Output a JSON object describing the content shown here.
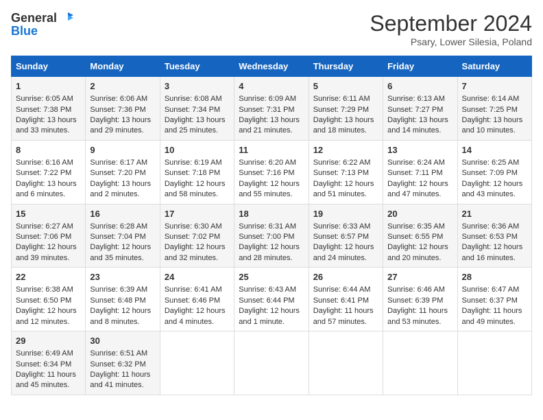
{
  "header": {
    "logo_line1": "General",
    "logo_line2": "Blue",
    "month": "September 2024",
    "location": "Psary, Lower Silesia, Poland"
  },
  "columns": [
    "Sunday",
    "Monday",
    "Tuesday",
    "Wednesday",
    "Thursday",
    "Friday",
    "Saturday"
  ],
  "weeks": [
    [
      {
        "day": "1",
        "lines": [
          "Sunrise: 6:05 AM",
          "Sunset: 7:38 PM",
          "Daylight: 13 hours",
          "and 33 minutes."
        ]
      },
      {
        "day": "2",
        "lines": [
          "Sunrise: 6:06 AM",
          "Sunset: 7:36 PM",
          "Daylight: 13 hours",
          "and 29 minutes."
        ]
      },
      {
        "day": "3",
        "lines": [
          "Sunrise: 6:08 AM",
          "Sunset: 7:34 PM",
          "Daylight: 13 hours",
          "and 25 minutes."
        ]
      },
      {
        "day": "4",
        "lines": [
          "Sunrise: 6:09 AM",
          "Sunset: 7:31 PM",
          "Daylight: 13 hours",
          "and 21 minutes."
        ]
      },
      {
        "day": "5",
        "lines": [
          "Sunrise: 6:11 AM",
          "Sunset: 7:29 PM",
          "Daylight: 13 hours",
          "and 18 minutes."
        ]
      },
      {
        "day": "6",
        "lines": [
          "Sunrise: 6:13 AM",
          "Sunset: 7:27 PM",
          "Daylight: 13 hours",
          "and 14 minutes."
        ]
      },
      {
        "day": "7",
        "lines": [
          "Sunrise: 6:14 AM",
          "Sunset: 7:25 PM",
          "Daylight: 13 hours",
          "and 10 minutes."
        ]
      }
    ],
    [
      {
        "day": "8",
        "lines": [
          "Sunrise: 6:16 AM",
          "Sunset: 7:22 PM",
          "Daylight: 13 hours",
          "and 6 minutes."
        ]
      },
      {
        "day": "9",
        "lines": [
          "Sunrise: 6:17 AM",
          "Sunset: 7:20 PM",
          "Daylight: 13 hours",
          "and 2 minutes."
        ]
      },
      {
        "day": "10",
        "lines": [
          "Sunrise: 6:19 AM",
          "Sunset: 7:18 PM",
          "Daylight: 12 hours",
          "and 58 minutes."
        ]
      },
      {
        "day": "11",
        "lines": [
          "Sunrise: 6:20 AM",
          "Sunset: 7:16 PM",
          "Daylight: 12 hours",
          "and 55 minutes."
        ]
      },
      {
        "day": "12",
        "lines": [
          "Sunrise: 6:22 AM",
          "Sunset: 7:13 PM",
          "Daylight: 12 hours",
          "and 51 minutes."
        ]
      },
      {
        "day": "13",
        "lines": [
          "Sunrise: 6:24 AM",
          "Sunset: 7:11 PM",
          "Daylight: 12 hours",
          "and 47 minutes."
        ]
      },
      {
        "day": "14",
        "lines": [
          "Sunrise: 6:25 AM",
          "Sunset: 7:09 PM",
          "Daylight: 12 hours",
          "and 43 minutes."
        ]
      }
    ],
    [
      {
        "day": "15",
        "lines": [
          "Sunrise: 6:27 AM",
          "Sunset: 7:06 PM",
          "Daylight: 12 hours",
          "and 39 minutes."
        ]
      },
      {
        "day": "16",
        "lines": [
          "Sunrise: 6:28 AM",
          "Sunset: 7:04 PM",
          "Daylight: 12 hours",
          "and 35 minutes."
        ]
      },
      {
        "day": "17",
        "lines": [
          "Sunrise: 6:30 AM",
          "Sunset: 7:02 PM",
          "Daylight: 12 hours",
          "and 32 minutes."
        ]
      },
      {
        "day": "18",
        "lines": [
          "Sunrise: 6:31 AM",
          "Sunset: 7:00 PM",
          "Daylight: 12 hours",
          "and 28 minutes."
        ]
      },
      {
        "day": "19",
        "lines": [
          "Sunrise: 6:33 AM",
          "Sunset: 6:57 PM",
          "Daylight: 12 hours",
          "and 24 minutes."
        ]
      },
      {
        "day": "20",
        "lines": [
          "Sunrise: 6:35 AM",
          "Sunset: 6:55 PM",
          "Daylight: 12 hours",
          "and 20 minutes."
        ]
      },
      {
        "day": "21",
        "lines": [
          "Sunrise: 6:36 AM",
          "Sunset: 6:53 PM",
          "Daylight: 12 hours",
          "and 16 minutes."
        ]
      }
    ],
    [
      {
        "day": "22",
        "lines": [
          "Sunrise: 6:38 AM",
          "Sunset: 6:50 PM",
          "Daylight: 12 hours",
          "and 12 minutes."
        ]
      },
      {
        "day": "23",
        "lines": [
          "Sunrise: 6:39 AM",
          "Sunset: 6:48 PM",
          "Daylight: 12 hours",
          "and 8 minutes."
        ]
      },
      {
        "day": "24",
        "lines": [
          "Sunrise: 6:41 AM",
          "Sunset: 6:46 PM",
          "Daylight: 12 hours",
          "and 4 minutes."
        ]
      },
      {
        "day": "25",
        "lines": [
          "Sunrise: 6:43 AM",
          "Sunset: 6:44 PM",
          "Daylight: 12 hours",
          "and 1 minute."
        ]
      },
      {
        "day": "26",
        "lines": [
          "Sunrise: 6:44 AM",
          "Sunset: 6:41 PM",
          "Daylight: 11 hours",
          "and 57 minutes."
        ]
      },
      {
        "day": "27",
        "lines": [
          "Sunrise: 6:46 AM",
          "Sunset: 6:39 PM",
          "Daylight: 11 hours",
          "and 53 minutes."
        ]
      },
      {
        "day": "28",
        "lines": [
          "Sunrise: 6:47 AM",
          "Sunset: 6:37 PM",
          "Daylight: 11 hours",
          "and 49 minutes."
        ]
      }
    ],
    [
      {
        "day": "29",
        "lines": [
          "Sunrise: 6:49 AM",
          "Sunset: 6:34 PM",
          "Daylight: 11 hours",
          "and 45 minutes."
        ]
      },
      {
        "day": "30",
        "lines": [
          "Sunrise: 6:51 AM",
          "Sunset: 6:32 PM",
          "Daylight: 11 hours",
          "and 41 minutes."
        ]
      },
      {
        "day": "",
        "lines": []
      },
      {
        "day": "",
        "lines": []
      },
      {
        "day": "",
        "lines": []
      },
      {
        "day": "",
        "lines": []
      },
      {
        "day": "",
        "lines": []
      }
    ]
  ]
}
